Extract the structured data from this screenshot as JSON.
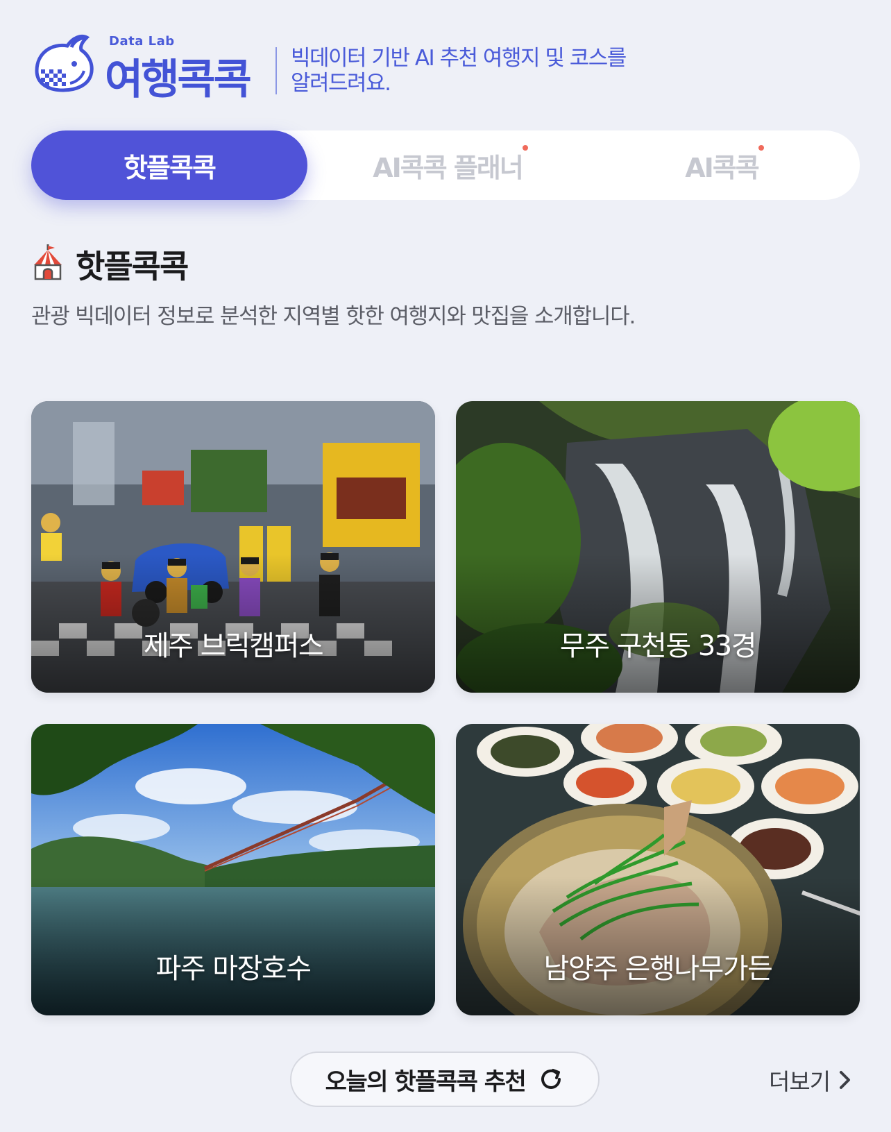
{
  "header": {
    "logo_sub": "Data Lab",
    "logo_title": "여행콕콕",
    "tagline_line1": "빅데이터 기반 AI 추천 여행지 및 코스를",
    "tagline_line2": "알려드려요."
  },
  "tabs": [
    {
      "label": "핫플콕콕",
      "active": true
    },
    {
      "label": "AI콕콕 플래너",
      "active": false,
      "new_dot": true
    },
    {
      "label": "AI콕콕",
      "active": false,
      "new_dot": true
    }
  ],
  "section": {
    "icon": "circus-tent-icon",
    "title": "핫플콕콕",
    "description": "관광 빅데이터 정보로 분석한 지역별 핫한 여행지와 맛집을 소개합니다."
  },
  "cards": [
    {
      "caption": "제주 브릭캠퍼스",
      "image": "lego-city-photo"
    },
    {
      "caption": "무주 구천동 33경",
      "image": "waterfall-photo"
    },
    {
      "caption": "파주 마장호수",
      "image": "lake-bridge-photo"
    },
    {
      "caption": "남양주 은행나무가든",
      "image": "korean-food-photo"
    }
  ],
  "footer": {
    "recommend_label": "오늘의 핫플콕콕 추천",
    "more_label": "더보기"
  },
  "colors": {
    "accent": "#5053d8",
    "logo": "#4353d6",
    "background": "#eef0f7",
    "new_dot": "#f06a5b"
  }
}
